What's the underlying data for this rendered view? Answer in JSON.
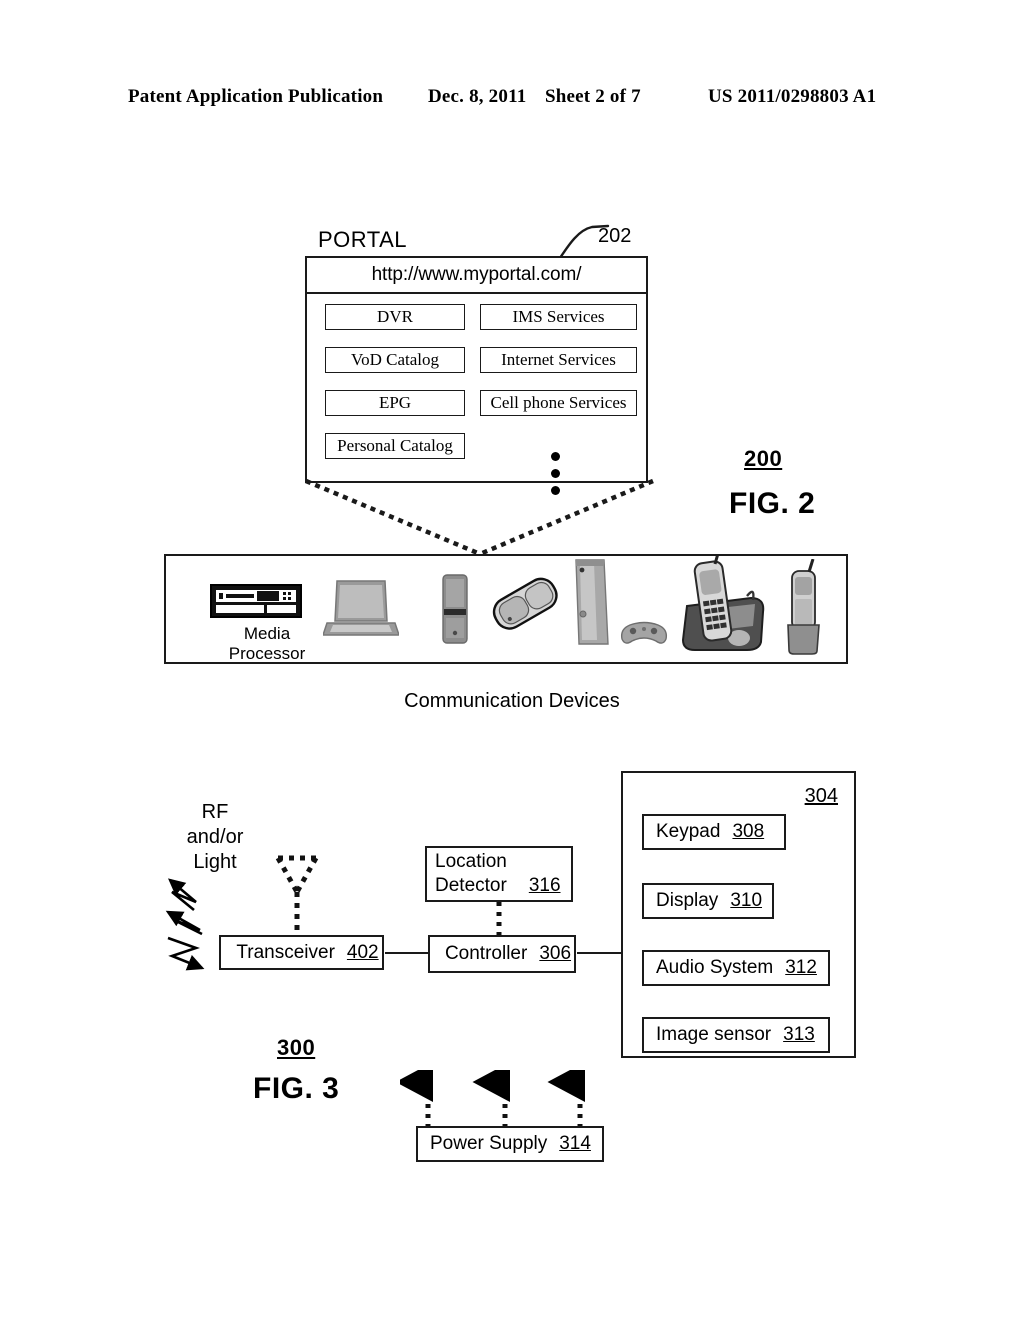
{
  "header": {
    "publication": "Patent Application Publication",
    "date": "Dec. 8, 2011",
    "sheet": "Sheet 2 of 7",
    "number": "US 2011/0298803 A1"
  },
  "figure2": {
    "ref": "200",
    "title": "FIG. 2",
    "portal": {
      "label": "PORTAL",
      "ref": "202",
      "url": "http://www.myportal.com/",
      "menu_left": [
        "DVR",
        "VoD Catalog",
        "EPG",
        "Personal Catalog"
      ],
      "menu_right": [
        "IMS Services",
        "Internet Services",
        "Cell phone Services"
      ],
      "ellipsis_dots": 3
    },
    "devices": {
      "caption": "Communication Devices",
      "media_processor_label": "Media\nProcessor",
      "media_processor_line1": "Media",
      "media_processor_line2": "Processor",
      "items": [
        "media-processor",
        "laptop",
        "cell-phone",
        "flip-phone",
        "game-console",
        "game-controller",
        "cordless-phone-base",
        "cordless-handset"
      ]
    }
  },
  "figure3": {
    "ref": "300",
    "title": "FIG. 3",
    "rf_label_line1": "RF",
    "rf_label_line2": "and/or",
    "rf_label_line3": "Light",
    "panel_ref": "304",
    "blocks": [
      {
        "name": "transceiver",
        "label": "Transceiver",
        "num": "402"
      },
      {
        "name": "controller",
        "label": "Controller",
        "num": "306"
      },
      {
        "name": "location",
        "label_line1": "Location",
        "label_line2": "Detector",
        "num": "316"
      },
      {
        "name": "keypad",
        "label": "Keypad",
        "num": "308"
      },
      {
        "name": "display",
        "label": "Display",
        "num": "310"
      },
      {
        "name": "audio-system",
        "label": "Audio System",
        "num": "312"
      },
      {
        "name": "image-sensor",
        "label": "Image sensor",
        "num": "313"
      },
      {
        "name": "power-supply",
        "label": "Power Supply",
        "num": "314"
      }
    ]
  },
  "colors": {
    "ink": "#1a1a1a",
    "paper": "#ffffff"
  }
}
